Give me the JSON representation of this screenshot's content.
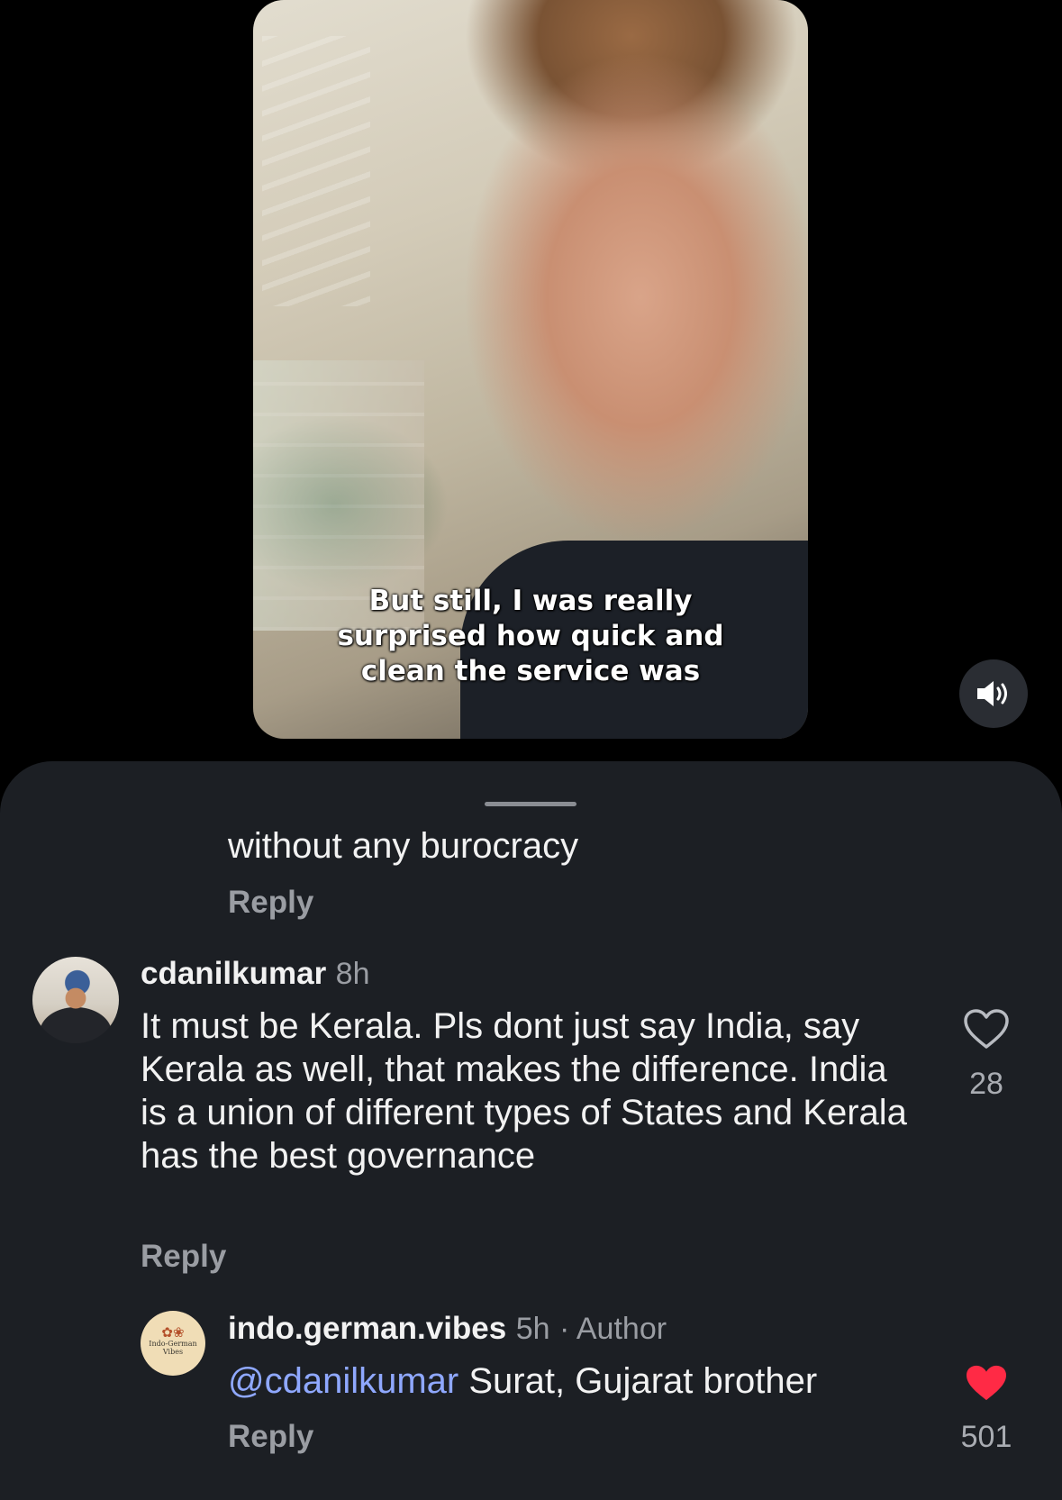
{
  "video": {
    "subtitle_lines": [
      "But still, I was really",
      "surprised how quick and",
      "clean the service was"
    ]
  },
  "comments": {
    "previous_text": "without any burocracy",
    "previous_reply_label": "Reply",
    "items": [
      {
        "username": "cdanilkumar",
        "time": "8h",
        "text": "It must be Kerala. Pls dont just say India, say Kerala as well, that makes the difference. India is a union of different types of States and Kerala has the best governance",
        "reply_label": "Reply",
        "like_count": "28",
        "liked": false
      },
      {
        "username": "indo.german.vibes",
        "time": "5h",
        "author_tag": "· Author",
        "mention": "@cdanilkumar",
        "text": " Surat, Gujarat brother",
        "reply_label": "Reply",
        "like_count": "501",
        "liked": true,
        "avatar_text": "Indo-German Vibes"
      }
    ]
  },
  "colors": {
    "sheet_bg": "#1c1f24",
    "mention": "#8fa8ff",
    "liked_heart": "#ff2a45"
  },
  "icons": {
    "mute": "speaker-icon",
    "like": "heart-icon"
  }
}
